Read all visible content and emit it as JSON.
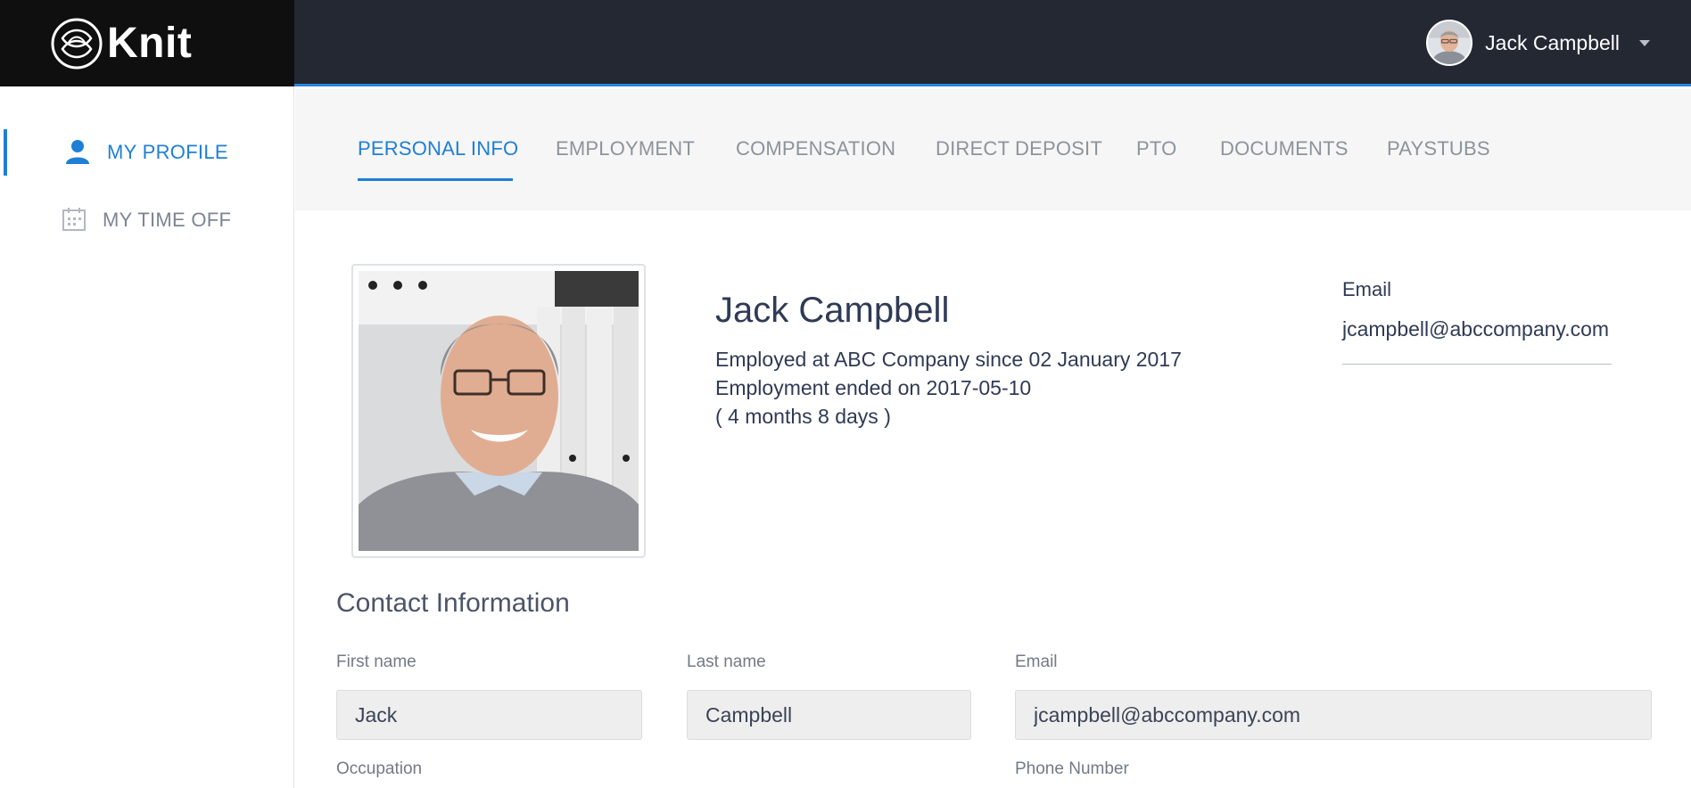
{
  "header": {
    "logo_text": "Knit",
    "user_name": "Jack Campbell"
  },
  "sidebar": {
    "items": [
      {
        "label": "MY PROFILE",
        "icon": "person-icon",
        "active": true
      },
      {
        "label": "MY TIME OFF",
        "icon": "calendar-icon",
        "active": false
      }
    ]
  },
  "tabs": [
    {
      "label": "PERSONAL INFO",
      "active": true
    },
    {
      "label": "EMPLOYMENT",
      "active": false
    },
    {
      "label": "COMPENSATION",
      "active": false
    },
    {
      "label": "DIRECT DEPOSIT",
      "active": false
    },
    {
      "label": "PTO",
      "active": false
    },
    {
      "label": "DOCUMENTS",
      "active": false
    },
    {
      "label": "PAYSTUBS",
      "active": false
    }
  ],
  "profile": {
    "name": "Jack Campbell",
    "employed_since": "Employed at ABC Company since 02 January 2017",
    "employment_ended": "Employment ended on 2017-05-10",
    "tenure": "( 4 months 8 days )",
    "email_label": "Email",
    "email_value": "jcampbell@abccompany.com"
  },
  "contact": {
    "title": "Contact Information",
    "first_name_label": "First name",
    "first_name_value": "Jack",
    "last_name_label": "Last name",
    "last_name_value": "Campbell",
    "email_label": "Email",
    "email_value": "jcampbell@abccompany.com",
    "occupation_label": "Occupation",
    "phone_label": "Phone Number"
  },
  "colors": {
    "accent": "#1e7fd6",
    "topbar": "#232833",
    "logo_bg": "#0f0f0f",
    "tabbar_bg": "#f6f6f6",
    "field_bg": "#eeeeee"
  }
}
